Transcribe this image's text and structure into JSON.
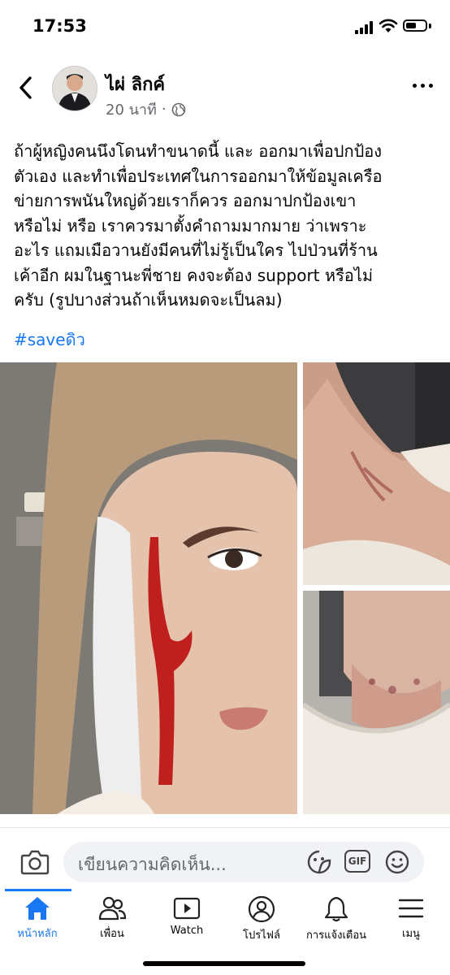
{
  "status_bar": {
    "time": "17:53",
    "battery_level": 0.55
  },
  "post": {
    "author_name": "ไผ่ ลิกค์",
    "timestamp": "20 นาที",
    "meta_separator": "·",
    "audience_icon": "globe-icon",
    "text": "ถ้าผู้หญิงคนนึงโดนทำขนาดนี้ และ ออกมาเพื่อปกป้อง\nตัวเอง และทำเพื่อประเทศในการออกมาให้ข้อมูลเครือ\nข่ายการพนันใหญ่ด้วยเราก็ควร ออกมาปกป้องเขา\nหรือไม่ หรือ เราควรมาตั้งคำถามมากมาย ว่าเพราะ\nอะไร แถมเมือวานยังมีคนที่ไม่รู้เป็นใคร ไปป่วนที่ร้าน\nเค้าอีก ผมในฐานะพี่ชาย คงจะต้อง support หรือไม่\nครับ (รูปบางส่วนถ้าเห็นหมดจะเป็นลม)",
    "hashtag": "#saveดิว"
  },
  "comment_bar": {
    "placeholder": "เขียนความคิดเห็น...",
    "gif_label": "GIF"
  },
  "bottom_nav": {
    "items": [
      {
        "label": "หน้าหลัก",
        "icon": "home-icon",
        "active": true
      },
      {
        "label": "เพื่อน",
        "icon": "friends-icon",
        "active": false
      },
      {
        "label": "Watch",
        "icon": "watch-icon",
        "active": false
      },
      {
        "label": "โปรไฟล์",
        "icon": "profile-icon",
        "active": false
      },
      {
        "label": "การแจ้งเตือน",
        "icon": "bell-icon",
        "active": false
      },
      {
        "label": "เมนู",
        "icon": "menu-icon",
        "active": false
      }
    ]
  },
  "colors": {
    "accent": "#1877f2",
    "secondary_text": "#65676b",
    "input_bg": "#f0f2f5"
  }
}
